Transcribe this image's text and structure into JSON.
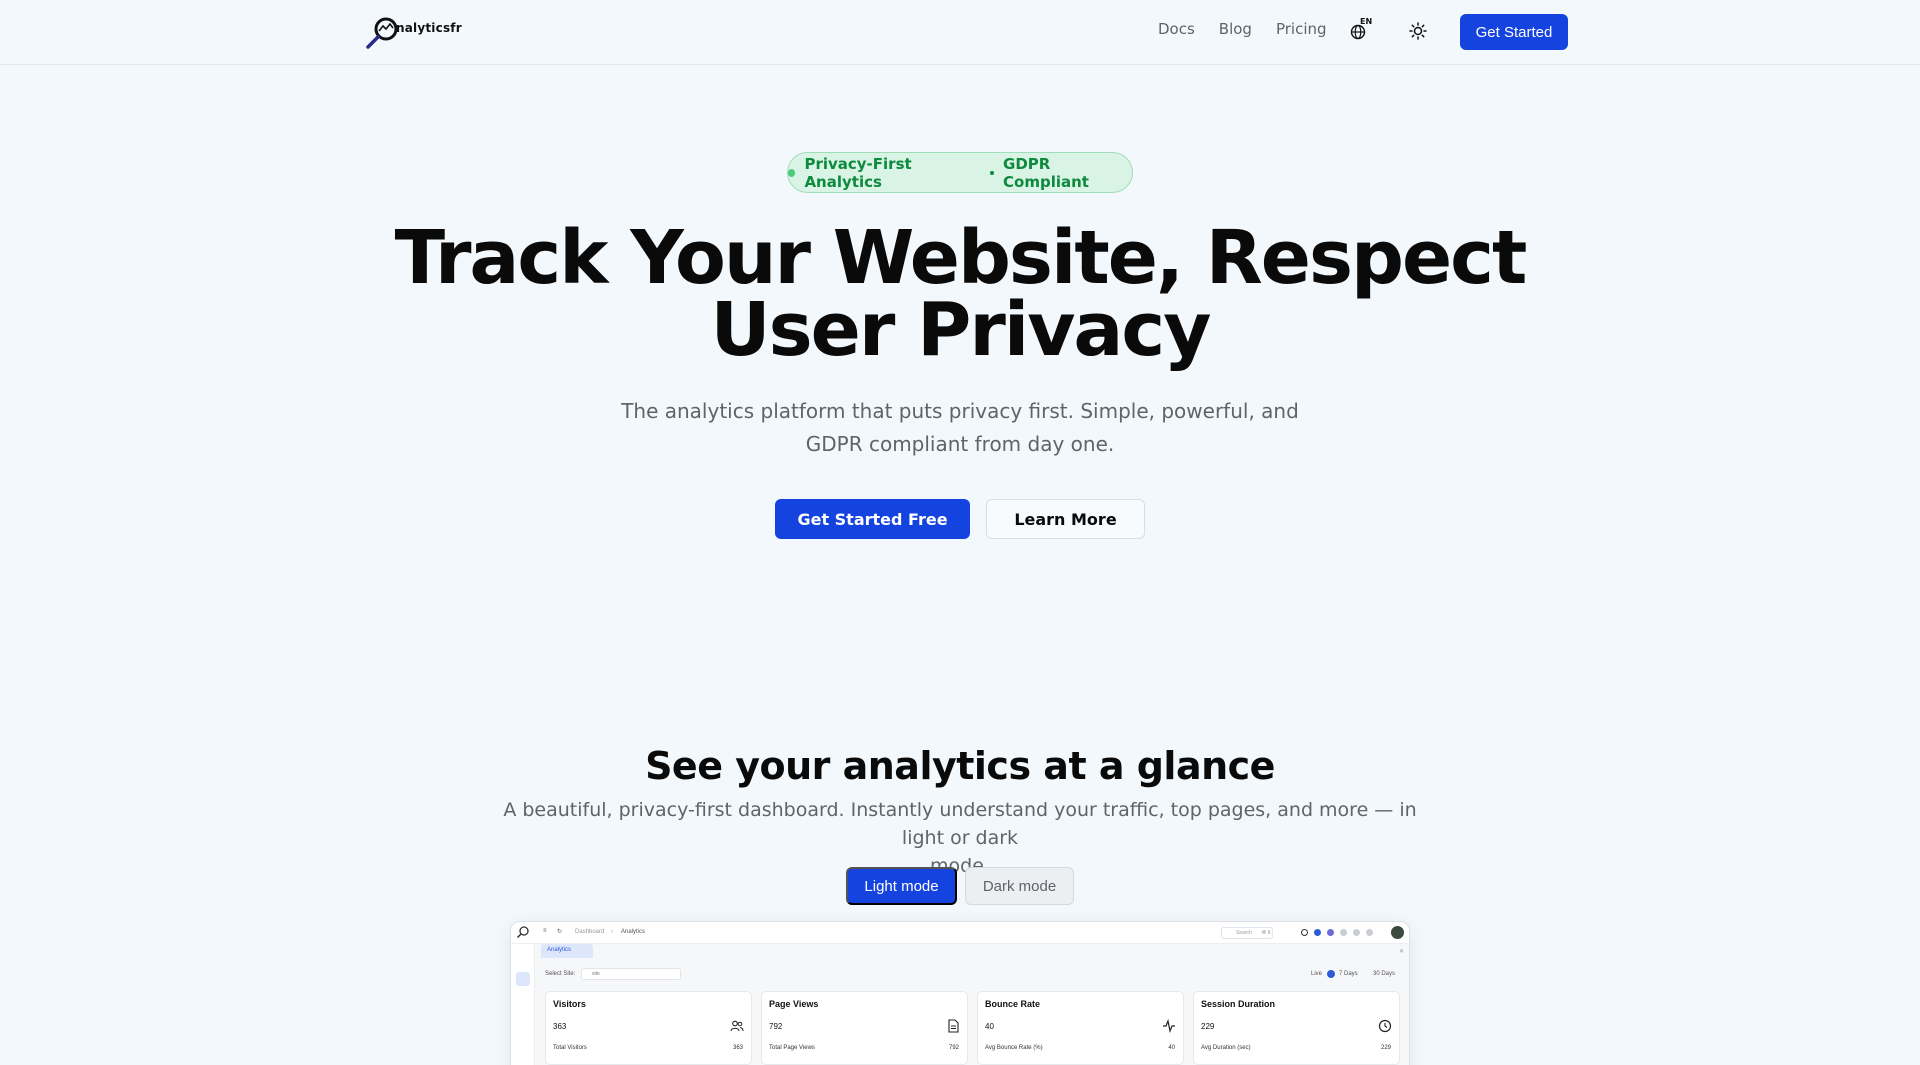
{
  "nav": {
    "logo_text": "nalyticsfr",
    "links": [
      "Docs",
      "Blog",
      "Pricing"
    ],
    "lang_label": "EN",
    "cta_label": "Get Started"
  },
  "hero": {
    "badge_left": "Privacy-First Analytics",
    "badge_right": "GDPR Compliant",
    "title_line1": "Track Your Website, Respect",
    "title_line2": "User Privacy",
    "subtitle_line1": "The analytics platform that puts privacy first. Simple, powerful, and",
    "subtitle_line2": "GDPR compliant from day one.",
    "primary_cta": "Get Started Free",
    "secondary_cta": "Learn More"
  },
  "showcase": {
    "title": "See your analytics at a glance",
    "subtitle_line1": "A beautiful, privacy-first dashboard. Instantly understand your traffic, top pages, and more — in light or dark",
    "subtitle_line2": "mode.",
    "light_mode_label": "Light mode",
    "dark_mode_label": "Dark mode"
  },
  "preview": {
    "breadcrumb_dashboard": "Dashboard",
    "breadcrumb_analytics": "Analytics",
    "tab_label": "Analytics",
    "search_placeholder": "Search",
    "search_shortcut": "⌘ K",
    "select_site_label": "Select Site:",
    "site_value": "site",
    "range_live": "Live",
    "range_7": "7 Days",
    "range_30": "30 Days",
    "cards": [
      {
        "title": "Visitors",
        "value": "363",
        "label": "Total Visitors",
        "right": "363"
      },
      {
        "title": "Page Views",
        "value": "792",
        "label": "Total Page Views",
        "right": "792"
      },
      {
        "title": "Bounce Rate",
        "value": "40",
        "label": "Avg Bounce Rate (%)",
        "right": "40"
      },
      {
        "title": "Session Duration",
        "value": "229",
        "label": "Avg Duration (sec)",
        "right": "229"
      }
    ]
  },
  "colors": {
    "accent": "#1443e0",
    "badge_text": "#0c8a3e",
    "badge_bg": "#d9f3e4",
    "background": "#f2f8fc"
  }
}
